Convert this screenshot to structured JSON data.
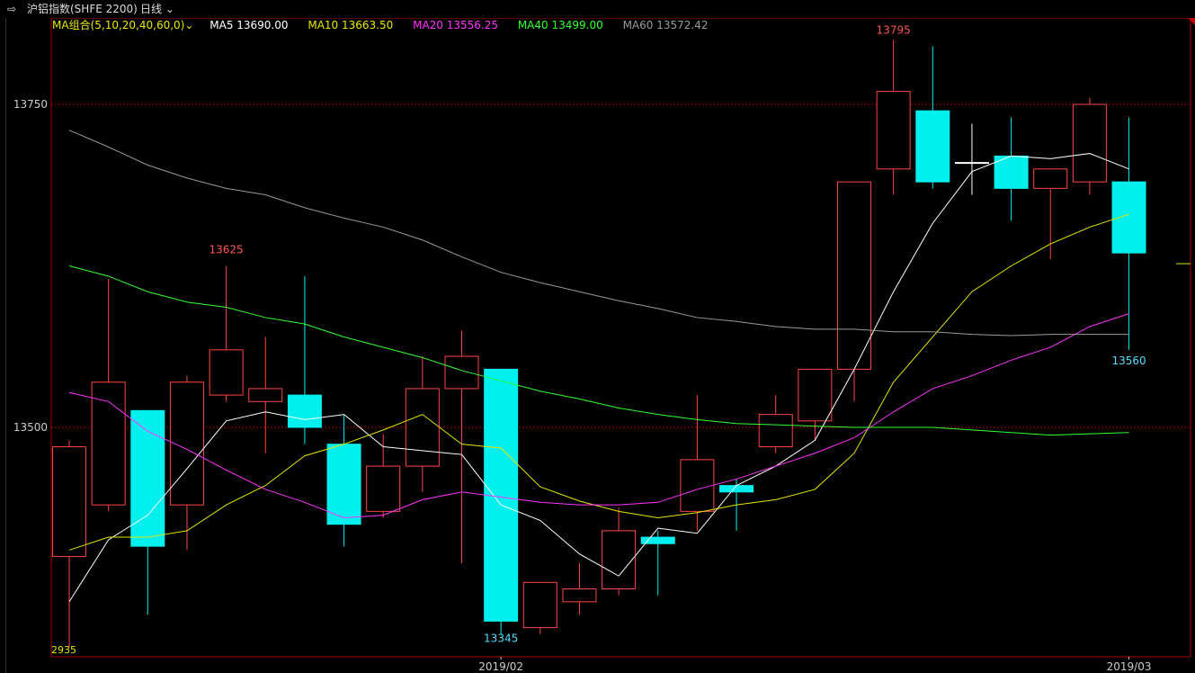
{
  "header": {
    "icon": "window-icon",
    "instrument": "沪铝指数(SHFE 2200)",
    "period": "日线",
    "period_icon": "chevron-down-icon"
  },
  "ma_legend": {
    "combo": "MA组合(5,10,20,40,60,0)",
    "items": [
      {
        "label": "MA5 13690.00",
        "color": "#ffffff"
      },
      {
        "label": "MA10 13663.50",
        "color": "#e6e600"
      },
      {
        "label": "MA20 13556.25",
        "color": "#ff33ff"
      },
      {
        "label": "MA40 13499.00",
        "color": "#33ff33"
      },
      {
        "label": "MA60 13572.42",
        "color": "#999999"
      }
    ]
  },
  "chart_data": {
    "type": "candlestick",
    "ylim": [
      13310,
      13825
    ],
    "yticks": [
      13750,
      13500
    ],
    "x_labels": [
      {
        "label": "2019/02",
        "index": 11
      },
      {
        "label": "2019/03",
        "index": 27
      }
    ],
    "annotations": [
      {
        "text": "13625",
        "index": 4,
        "value": 13625,
        "color": "#ff5555",
        "pos": "above"
      },
      {
        "text": "13345",
        "index": 11,
        "value": 13345,
        "color": "#55ddff",
        "pos": "below"
      },
      {
        "text": "13795",
        "index": 21,
        "value": 13795,
        "color": "#ff5555",
        "pos": "above"
      },
      {
        "text": "13560",
        "index": 27,
        "value": 13560,
        "color": "#55ddff",
        "pos": "below"
      }
    ],
    "bottom_left_label": "2935",
    "colors": {
      "up": "#ff4444",
      "down": "#00f0f0",
      "flat": "#ffffff",
      "grid": "#aa0000",
      "axis_text": "#cccccc"
    },
    "candles": [
      {
        "o": 13400,
        "h": 13490,
        "l": 13330,
        "c": 13485
      },
      {
        "o": 13440,
        "h": 13615,
        "l": 13435,
        "c": 13535
      },
      {
        "o": 13513,
        "h": 13513,
        "l": 13355,
        "c": 13408
      },
      {
        "o": 13440,
        "h": 13540,
        "l": 13405,
        "c": 13535
      },
      {
        "o": 13525,
        "h": 13625,
        "l": 13520,
        "c": 13560
      },
      {
        "o": 13520,
        "h": 13570,
        "l": 13480,
        "c": 13530
      },
      {
        "o": 13525,
        "h": 13617,
        "l": 13487,
        "c": 13500
      },
      {
        "o": 13487,
        "h": 13510,
        "l": 13408,
        "c": 13425
      },
      {
        "o": 13435,
        "h": 13495,
        "l": 13430,
        "c": 13470
      },
      {
        "o": 13470,
        "h": 13555,
        "l": 13450,
        "c": 13530
      },
      {
        "o": 13530,
        "h": 13575,
        "l": 13395,
        "c": 13555
      },
      {
        "o": 13545,
        "h": 13545,
        "l": 13340,
        "c": 13350
      },
      {
        "o": 13345,
        "h": 13365,
        "l": 13340,
        "c": 13380
      },
      {
        "o": 13365,
        "h": 13395,
        "l": 13355,
        "c": 13375
      },
      {
        "o": 13375,
        "h": 13438,
        "l": 13370,
        "c": 13420
      },
      {
        "o": 13415,
        "h": 13420,
        "l": 13370,
        "c": 13410
      },
      {
        "o": 13435,
        "h": 13525,
        "l": 13420,
        "c": 13475
      },
      {
        "o": 13455,
        "h": 13460,
        "l": 13420,
        "c": 13450
      },
      {
        "o": 13485,
        "h": 13525,
        "l": 13480,
        "c": 13510
      },
      {
        "o": 13505,
        "h": 13545,
        "l": 13490,
        "c": 13545
      },
      {
        "o": 13545,
        "h": 13690,
        "l": 13520,
        "c": 13690
      },
      {
        "o": 13700,
        "h": 13800,
        "l": 13680,
        "c": 13760
      },
      {
        "o": 13745,
        "h": 13795,
        "l": 13685,
        "c": 13690
      },
      {
        "o": 13705,
        "h": 13735,
        "l": 13680,
        "c": 13705
      },
      {
        "o": 13710,
        "h": 13740,
        "l": 13660,
        "c": 13685
      },
      {
        "o": 13685,
        "h": 13700,
        "l": 13630,
        "c": 13700
      },
      {
        "o": 13690,
        "h": 13755,
        "l": 13680,
        "c": 13750
      },
      {
        "o": 13690,
        "h": 13740,
        "l": 13560,
        "c": 13635
      }
    ],
    "series": [
      {
        "name": "MA5",
        "color": "#ffffff",
        "values": [
          13365,
          13413,
          13432,
          13468,
          13505,
          13512,
          13506,
          13510,
          13485,
          13482,
          13479,
          13440,
          13428,
          13402,
          13385,
          13422,
          13418,
          13455,
          13470,
          13490,
          13545,
          13605,
          13658,
          13698,
          13710,
          13708,
          13712,
          13700
        ]
      },
      {
        "name": "MA10",
        "color": "#e6e600",
        "values": [
          13405,
          13415,
          13415,
          13420,
          13440,
          13455,
          13478,
          13487,
          13498,
          13510,
          13487,
          13484,
          13454,
          13443,
          13435,
          13430,
          13434,
          13440,
          13444,
          13452,
          13480,
          13535,
          13570,
          13605,
          13625,
          13642,
          13655,
          13665
        ]
      },
      {
        "name": "MA20",
        "color": "#ff33ff",
        "values": [
          13527,
          13520,
          13497,
          13483,
          13467,
          13452,
          13442,
          13430,
          13432,
          13444,
          13450,
          13446,
          13442,
          13440,
          13440,
          13442,
          13452,
          13460,
          13470,
          13480,
          13492,
          13512,
          13530,
          13540,
          13552,
          13562,
          13578,
          13588
        ]
      },
      {
        "name": "MA40",
        "color": "#33ff33",
        "values": [
          13625,
          13617,
          13605,
          13597,
          13593,
          13585,
          13580,
          13570,
          13562,
          13554,
          13544,
          13536,
          13528,
          13522,
          13515,
          13510,
          13506,
          13503,
          13502,
          13501,
          13500,
          13500,
          13500,
          13498,
          13496,
          13494,
          13495,
          13496
        ]
      },
      {
        "name": "MA60",
        "color": "#999999",
        "values": [
          13730,
          13717,
          13703,
          13693,
          13685,
          13680,
          13670,
          13662,
          13655,
          13645,
          13632,
          13620,
          13612,
          13605,
          13598,
          13592,
          13585,
          13582,
          13578,
          13576,
          13576,
          13574,
          13574,
          13572,
          13571,
          13572,
          13572,
          13572
        ]
      }
    ]
  }
}
